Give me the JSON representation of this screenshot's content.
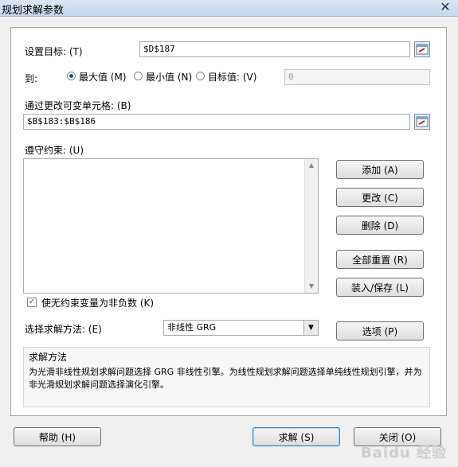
{
  "window": {
    "title": "规划求解参数",
    "close_glyph": "✕"
  },
  "objective": {
    "label": "设置目标: (T)",
    "value": "$D$187"
  },
  "to": {
    "label": "到:",
    "options": [
      {
        "label": "最大值 (M)",
        "selected": true
      },
      {
        "label": "最小值 (N)",
        "selected": false
      },
      {
        "label": "目标值: (V)",
        "selected": false
      }
    ],
    "value_of": "0"
  },
  "changing_cells": {
    "label": "通过更改可变单元格: (B)",
    "value": "$B$183:$B$186"
  },
  "constraints": {
    "label": "遵守约束: (U)",
    "items": []
  },
  "constraint_buttons": {
    "add": "添加 (A)",
    "change": "更改 (C)",
    "delete": "删除 (D)",
    "reset_all": "全部重置 (R)",
    "load_save": "装入/保存 (L)"
  },
  "nonneg": {
    "label": "使无约束变量为非负数 (K)",
    "checked": true,
    "check_glyph": "✓"
  },
  "method": {
    "label": "选择求解方法: (E)",
    "selected": "非线性 GRG",
    "options_button": "选项 (P)"
  },
  "method_desc": {
    "title": "求解方法",
    "text": "为光滑非线性规划求解问题选择 GRG 非线性引擎。为线性规划求解问题选择单纯线性规划引擎，并为非光滑规划求解问题选择演化引擎。"
  },
  "footer": {
    "help": "帮助 (H)",
    "solve": "求解 (S)",
    "close": "关闭 (O)"
  },
  "watermark": "Baidu 经验",
  "colors": {
    "panel_border": "#a7a7a7",
    "default_button": "#3c7fb1"
  }
}
